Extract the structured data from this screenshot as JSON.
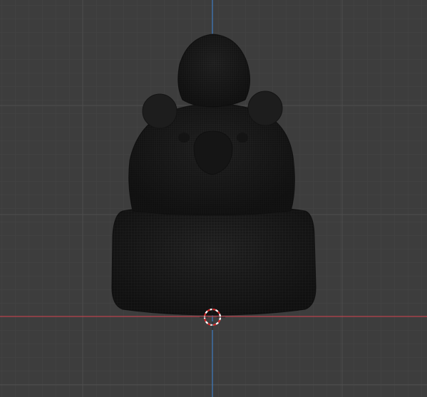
{
  "viewport": {
    "background": "#3d3d3d",
    "grid_minor_color": "#444444",
    "grid_major_color": "#4f4f4f",
    "x_axis_color": "#b8434d",
    "z_axis_color": "#3f7dc0"
  },
  "model": {
    "name": "mesh-object",
    "mode": "wireframe",
    "fill_color": "#1c1c1c",
    "wire_color": "#2e2e2e"
  },
  "cursor": {
    "name": "3d-cursor",
    "colors": [
      "#d42a2a",
      "#ffffff"
    ]
  }
}
